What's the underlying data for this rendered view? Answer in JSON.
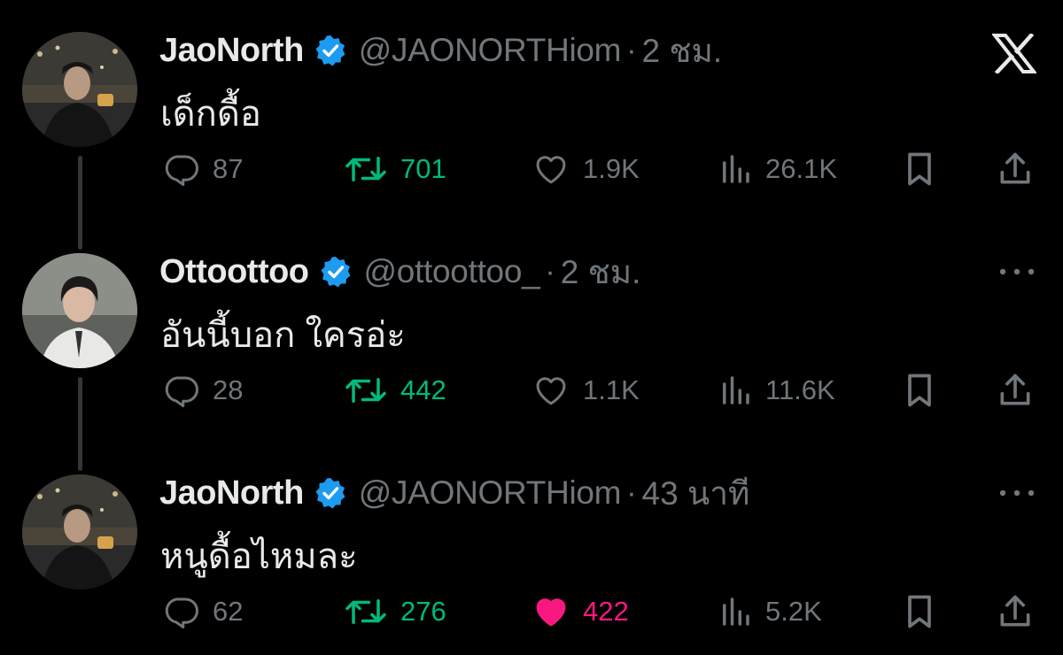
{
  "tweets": [
    {
      "name": "JaoNorth",
      "handle": "@JAONORTHiom",
      "separator": "·",
      "time": "2 ชม.",
      "text": "เด็กดื้อ",
      "replies": "87",
      "retweets": "701",
      "likes": "1.9K",
      "views": "26.1K",
      "liked": false
    },
    {
      "name": "Ottoottoo",
      "handle": "@ottoottoo_",
      "separator": "·",
      "time": "2 ชม.",
      "text": "อันนี้บอก ใครอ่ะ",
      "replies": "28",
      "retweets": "442",
      "likes": "1.1K",
      "views": "11.6K",
      "liked": false
    },
    {
      "name": "JaoNorth",
      "handle": "@JAONORTHiom",
      "separator": "·",
      "time": "43 นาที",
      "text": "หนูดื้อไหมละ",
      "replies": "62",
      "retweets": "276",
      "likes": "422",
      "views": "5.2K",
      "liked": true
    }
  ],
  "icons": {
    "close": "x-logo-icon",
    "more": "more-dots-icon",
    "reply": "reply-icon",
    "retweet": "retweet-icon",
    "like": "heart-icon",
    "views": "views-icon",
    "bookmark": "bookmark-icon",
    "share": "share-icon",
    "verified": "verified-badge-icon"
  },
  "colors": {
    "background": "#000000",
    "text": "#e7e9ea",
    "muted": "#71767b",
    "retweet": "#00ba7c",
    "like": "#f91880",
    "verified": "#1d9bf0"
  }
}
